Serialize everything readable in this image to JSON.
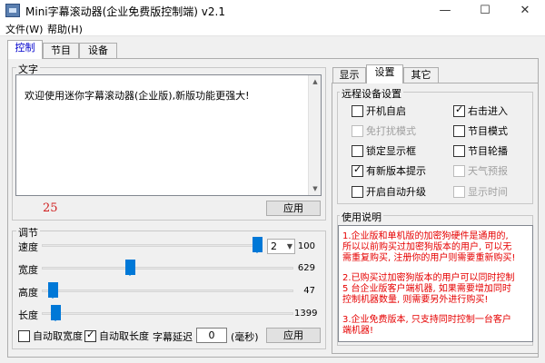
{
  "window": {
    "title": "Mini字幕滚动器(企业免费版控制端) v2.1",
    "min_glyph": "—",
    "max_glyph": "☐",
    "close_glyph": "✕"
  },
  "menu": {
    "items": [
      "文件(W)",
      "帮助(H)"
    ]
  },
  "main_tabs": [
    "控制",
    "节目",
    "设备"
  ],
  "text_group": {
    "title": "文字",
    "content": "欢迎使用迷你字幕滚动器(企业版),新版功能更强大!",
    "count": "25",
    "apply_label": "应用"
  },
  "adjust_group": {
    "title": "调节",
    "sliders": [
      {
        "label": "速度",
        "value": "100"
      },
      {
        "label": "宽度",
        "value": "629"
      },
      {
        "label": "高度",
        "value": "47"
      },
      {
        "label": "长度",
        "value": "1399"
      }
    ],
    "speed_select": "2",
    "auto_width_label": "自动取宽度",
    "auto_width_checked": false,
    "auto_length_label": "自动取长度",
    "auto_length_checked": true,
    "delay_label": "字幕延迟",
    "delay_value": "0",
    "delay_unit": "(毫秒)",
    "apply_label": "应用"
  },
  "right_tabs": [
    "显示",
    "设置",
    "其它"
  ],
  "remote_settings": {
    "title": "远程设备设置",
    "options": [
      {
        "label": "开机自启",
        "checked": false,
        "disabled": false
      },
      {
        "label": "右击进入",
        "checked": true,
        "disabled": false
      },
      {
        "label": "免打扰模式",
        "checked": false,
        "disabled": true
      },
      {
        "label": "节目模式",
        "checked": false,
        "disabled": false
      },
      {
        "label": "锁定显示框",
        "checked": false,
        "disabled": false
      },
      {
        "label": "节目轮播",
        "checked": false,
        "disabled": false
      },
      {
        "label": "有新版本提示",
        "checked": true,
        "disabled": false
      },
      {
        "label": "天气预报",
        "checked": false,
        "disabled": true
      },
      {
        "label": "开启自动升级",
        "checked": false,
        "disabled": false
      },
      {
        "label": "显示时间",
        "checked": false,
        "disabled": true
      }
    ]
  },
  "help": {
    "title": "使用说明",
    "paragraphs": [
      "1.企业版和单机版的加密狗硬件是通用的, 所以以前购买过加密狗版本的用户, 可以无需重复购买, 注册你的用户则需要重新购买!",
      "2.已购买过加密狗版本的用户可以同时控制 5 台企业版客户端机器, 如果需要增加同时控制机器数量, 则需要另外进行购买!",
      "3.企业免费版本, 只支持同时控制一台客户端机器!"
    ]
  },
  "colors": {
    "accent": "#0078d7",
    "warning_text": "#e60000",
    "counter": "#d02020"
  }
}
